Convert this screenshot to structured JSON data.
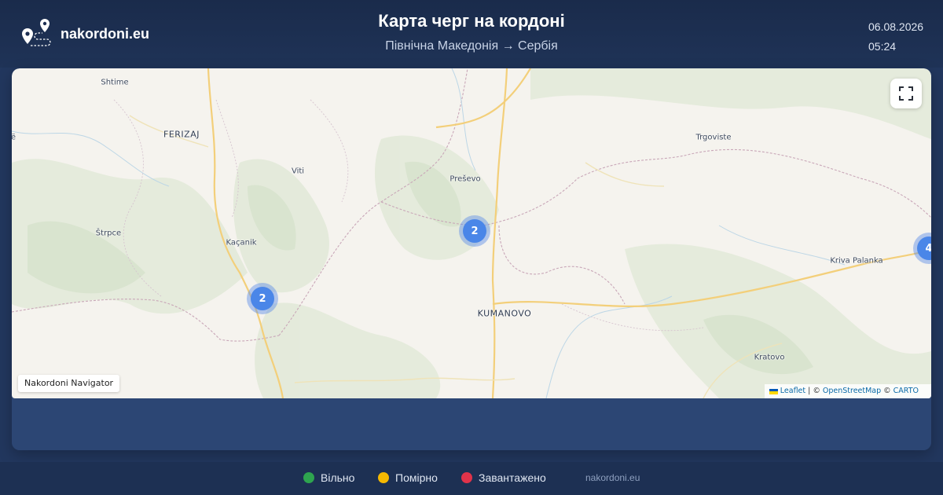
{
  "header": {
    "brand": "nakordoni.eu",
    "title": "Карта черг на кордоні",
    "subtitle": "Північна Македонія → Сербія",
    "date": "06.08.2026",
    "time": "05:24"
  },
  "map": {
    "places": [
      {
        "name": "Shtime",
        "type": "town"
      },
      {
        "name": "FERIZAJ",
        "type": "city"
      },
      {
        "name": "Viti",
        "type": "town"
      },
      {
        "name": "Štrpce",
        "type": "town"
      },
      {
        "name": "Kaçanik",
        "type": "town"
      },
      {
        "name": "Preševo",
        "type": "town"
      },
      {
        "name": "KUMANOVO",
        "type": "city"
      },
      {
        "name": "Trgoviste",
        "type": "town"
      },
      {
        "name": "Kriva Palanka",
        "type": "town"
      },
      {
        "name": "Kratovo",
        "type": "town"
      },
      {
        "name": "ë",
        "type": "town"
      }
    ],
    "clusters": [
      {
        "count": "2"
      },
      {
        "count": "2"
      },
      {
        "count": "4"
      }
    ],
    "nav_label": "Nakordoni Navigator",
    "attribution": {
      "leaflet": "Leaflet",
      "sep1": "| ©",
      "osm": "OpenStreetMap",
      "sep2": "©",
      "carto": "CARTO"
    },
    "colors": {
      "cluster": "#4a86e8",
      "flag_blue": "#0057b7",
      "flag_yellow": "#ffd700"
    }
  },
  "legend": [
    {
      "label": "Вільно",
      "color": "#2ea44f"
    },
    {
      "label": "Помірно",
      "color": "#f5b800"
    },
    {
      "label": "Завантажено",
      "color": "#e0334a"
    }
  ],
  "footer": {
    "site": "nakordoni.eu"
  },
  "icons": {
    "brand": "map-pin-route-icon",
    "fullscreen": "fullscreen-icon"
  }
}
